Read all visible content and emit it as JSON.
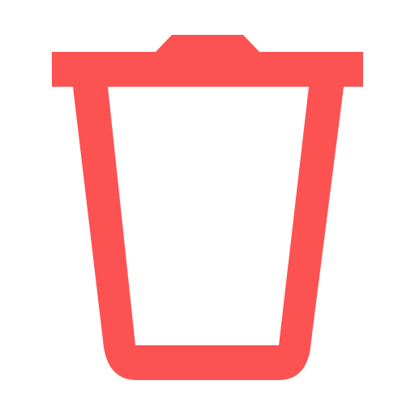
{
  "icon": {
    "name": "trash-icon",
    "color": "#fd5252",
    "background": "#ffffff"
  }
}
